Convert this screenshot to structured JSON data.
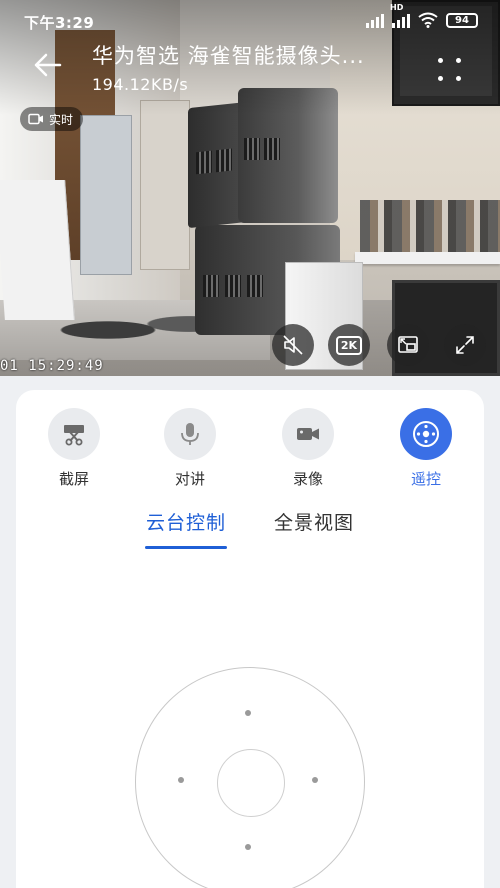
{
  "status_bar": {
    "time": "下午3:29",
    "battery": "94",
    "network_badge": "HD"
  },
  "header": {
    "title": "华为智选 海雀智能摄像头...",
    "speed": "194.12KB/s"
  },
  "video": {
    "live_badge": "实时",
    "timestamp": "01 15:29:49",
    "resolution_badge": "2K"
  },
  "toolbar": {
    "items": [
      {
        "label": "截屏",
        "icon": "scissors-icon",
        "active": false
      },
      {
        "label": "对讲",
        "icon": "microphone-icon",
        "active": false
      },
      {
        "label": "录像",
        "icon": "video-camera-icon",
        "active": false
      },
      {
        "label": "遥控",
        "icon": "dpad-icon",
        "active": true
      }
    ]
  },
  "tabs": [
    {
      "label": "云台控制",
      "active": true
    },
    {
      "label": "全景视图",
      "active": false
    }
  ],
  "colors": {
    "accent": "#3a6fe6",
    "tab_active": "#1f5fd6",
    "panel_bg": "#ffffff",
    "page_bg": "#eef0f3"
  }
}
